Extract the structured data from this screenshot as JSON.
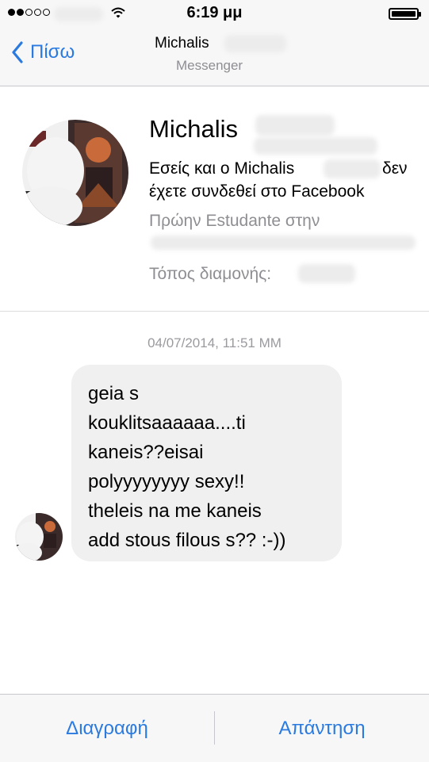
{
  "status_bar": {
    "time": "6:19 μμ",
    "signal_icon": "signal-dots-icon",
    "wifi_icon": "wifi-icon",
    "battery_icon": "battery-icon",
    "battery_level": 1.0
  },
  "nav": {
    "back_icon": "chevron-left-icon",
    "back_label": "Πίσω",
    "title": "Michalis",
    "subtitle": "Messenger"
  },
  "profile": {
    "name": "Michalis",
    "connection_line_1": "Εσείς και ο Michalis",
    "connection_line_1_end": "δεν",
    "connection_line_2": "έχετε συνδεθεί στο Facebook",
    "education": "Πρώην Estudante στην",
    "residence_label": "Τόπος διαμονής:"
  },
  "conversation": {
    "timestamp": "04/07/2014, 11:51 MM",
    "message": "geia s\nkouklitsaaaaaa....ti\nkaneis??eisai\npolyyyyyyyy sexy!!\ntheleis na me kaneis\nadd stous filous s?? :-))"
  },
  "toolbar": {
    "delete_label": "Διαγραφή",
    "reply_label": "Απάντηση"
  },
  "colors": {
    "accent": "#2a7ae0",
    "bubble": "#f1f0f0",
    "bar_background": "#f7f7f7",
    "secondary_text": "#8e8e93"
  }
}
